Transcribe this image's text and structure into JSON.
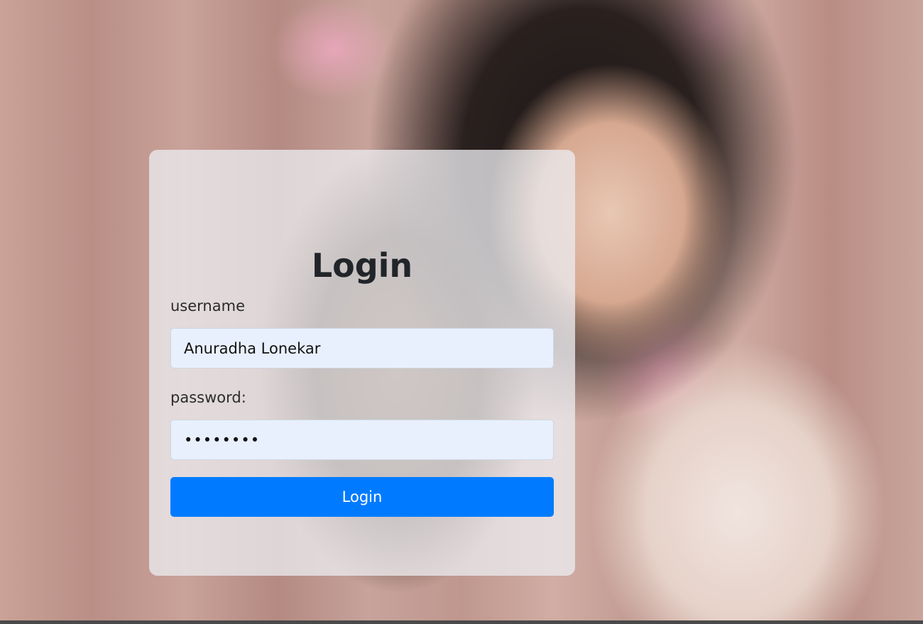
{
  "login": {
    "title": "Login",
    "username_label": "username",
    "username_value": "Anuradha Lonekar",
    "password_label": "password:",
    "password_value": "••••••••",
    "button_label": "Login"
  },
  "colors": {
    "button_bg": "#007bff",
    "input_bg": "#e8f0fe",
    "title_text": "#212529"
  }
}
